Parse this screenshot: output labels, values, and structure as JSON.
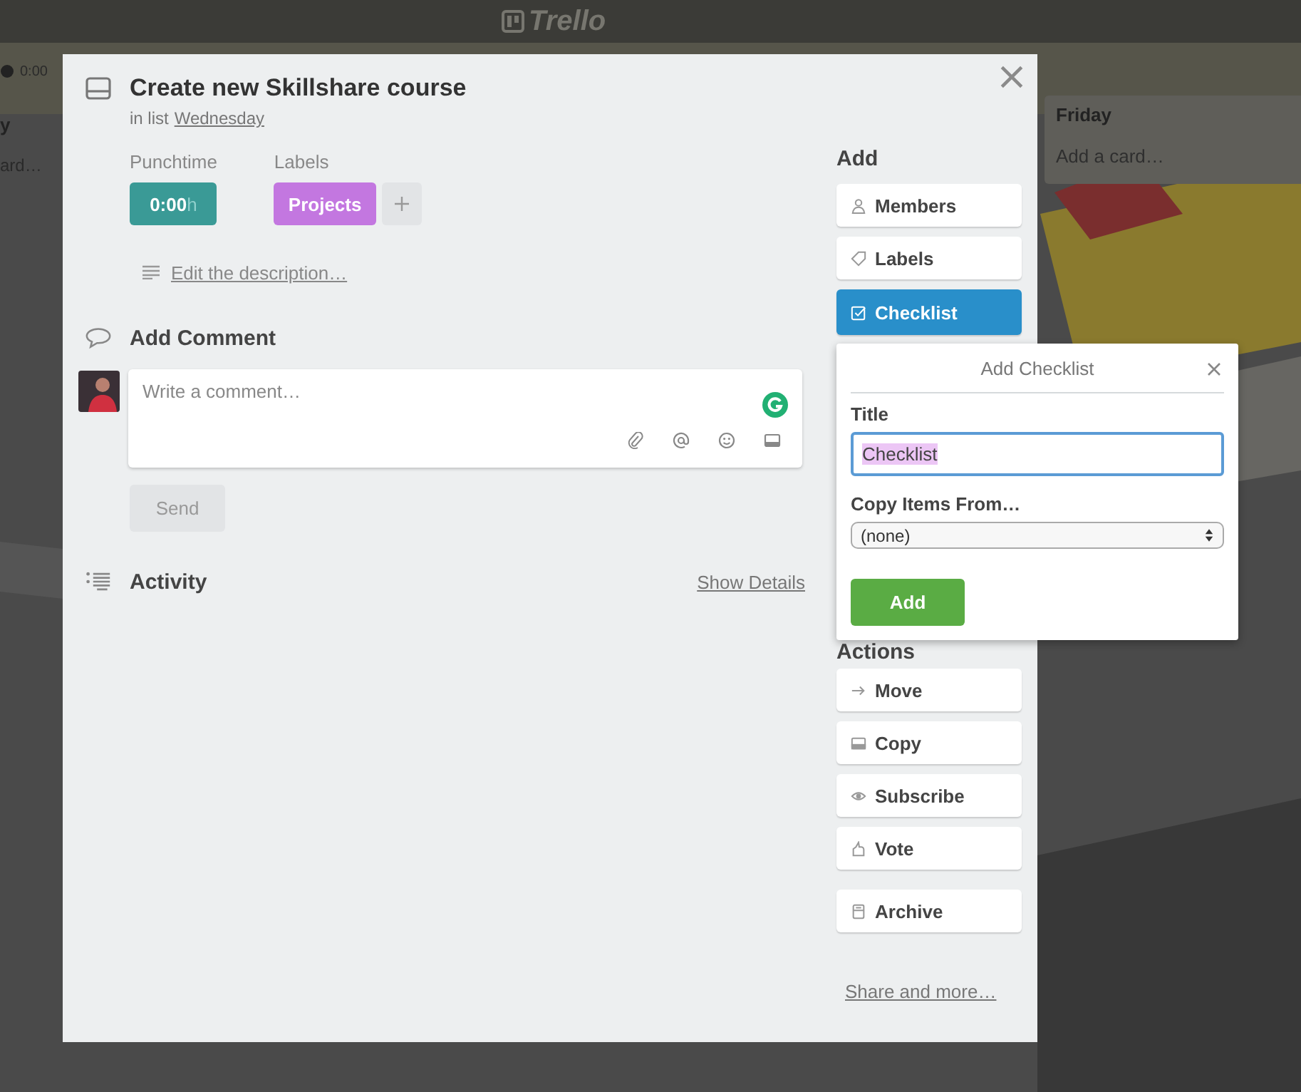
{
  "board": {
    "logo": "Trello",
    "left_list": {
      "badge": "0:00",
      "title": "y",
      "add_card": "ard…"
    },
    "right_list": {
      "title": "Friday",
      "add_card": "Add a card…"
    }
  },
  "card": {
    "title": "Create new Skillshare course",
    "list_prefix": "in list",
    "list_name": "Wednesday",
    "punchtime": {
      "label": "Punchtime",
      "value": "0:00",
      "unit": "h"
    },
    "labels": {
      "heading": "Labels",
      "items": [
        {
          "text": "Projects",
          "color": "#c377e0"
        }
      ]
    },
    "description_link": "Edit the description…",
    "comment": {
      "heading": "Add Comment",
      "placeholder": "Write a comment…",
      "send": "Send",
      "send_disabled": true
    },
    "activity": {
      "heading": "Activity",
      "link": "Show Details"
    },
    "add": {
      "heading": "Add",
      "buttons": [
        {
          "kind": "members",
          "label": "Members",
          "selected": false
        },
        {
          "kind": "labels",
          "label": "Labels",
          "selected": false
        },
        {
          "kind": "checklist",
          "label": "Checklist",
          "selected": true
        }
      ]
    },
    "actions": {
      "heading": "Actions",
      "buttons": [
        {
          "kind": "move",
          "label": "Move",
          "selected": false
        },
        {
          "kind": "copy",
          "label": "Copy",
          "selected": false
        },
        {
          "kind": "subscribe",
          "label": "Subscribe",
          "selected": false
        },
        {
          "kind": "vote",
          "label": "Vote",
          "selected": false
        },
        {
          "kind": "archive",
          "label": "Archive",
          "selected": false
        }
      ]
    },
    "share_link": "Share and more…"
  },
  "popover": {
    "title": "Add Checklist",
    "title_label": "Title",
    "title_value": "Checklist",
    "title_value_highlighted": true,
    "copy_label": "Copy Items From…",
    "copy_value": "(none)",
    "submit": "Add"
  }
}
